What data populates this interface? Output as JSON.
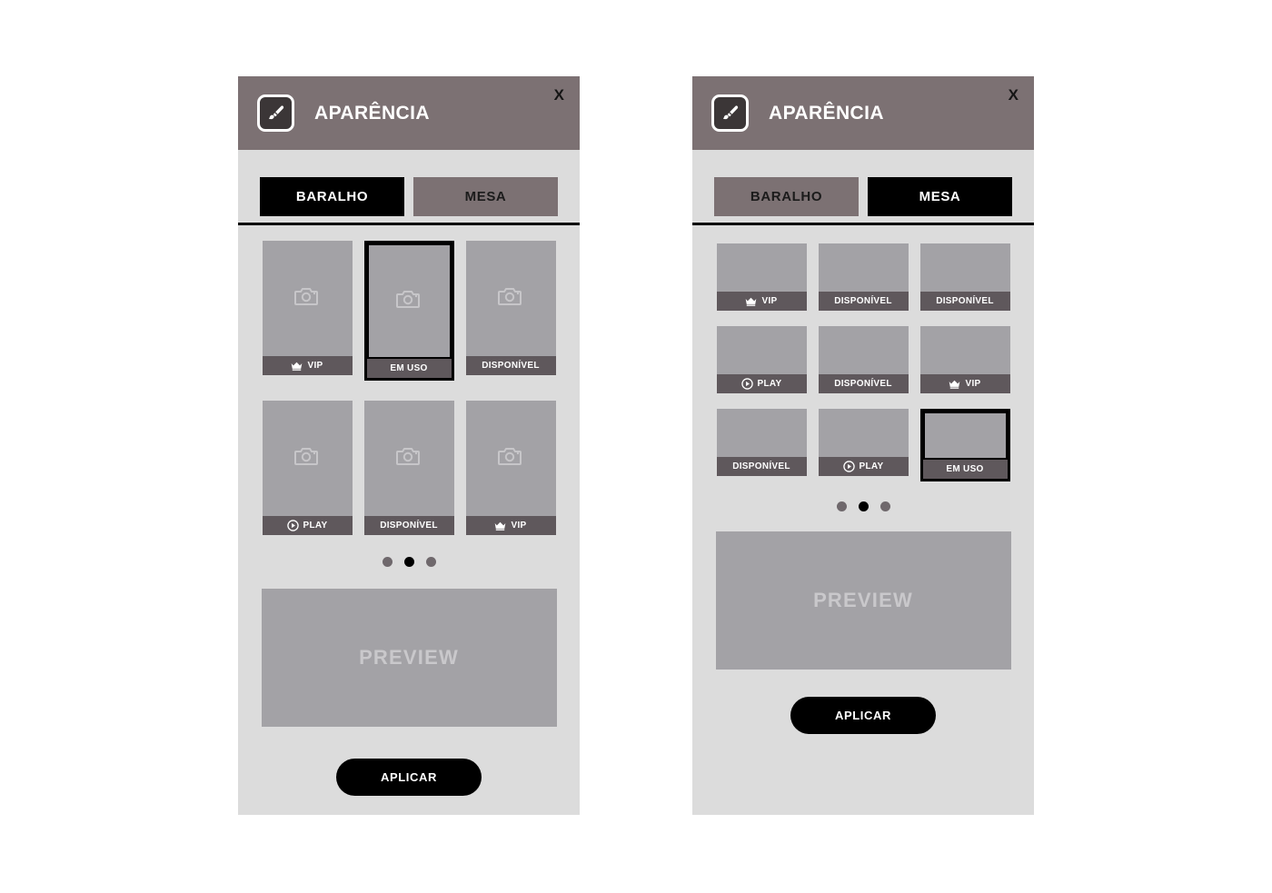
{
  "panels": [
    {
      "id": "baralho",
      "header": {
        "title": "APARÊNCIA",
        "icon": "paintbrush-icon",
        "close_label": "X"
      },
      "tabs": [
        {
          "label": "BARALHO",
          "active": true
        },
        {
          "label": "MESA",
          "active": false
        }
      ],
      "cards": [
        {
          "label": "VIP",
          "icon": "crown-icon",
          "thumb_icon": "camera-icon",
          "selected": false
        },
        {
          "label": "EM USO",
          "icon": null,
          "thumb_icon": "camera-icon",
          "selected": true
        },
        {
          "label": "DISPONÍVEL",
          "icon": null,
          "thumb_icon": "camera-icon",
          "selected": false
        },
        {
          "label": "PLAY",
          "icon": "play-icon",
          "thumb_icon": "camera-icon",
          "selected": false
        },
        {
          "label": "DISPONÍVEL",
          "icon": null,
          "thumb_icon": "camera-icon",
          "selected": false
        },
        {
          "label": "VIP",
          "icon": "crown-icon",
          "thumb_icon": "camera-icon",
          "selected": false
        }
      ],
      "pagination": {
        "count": 3,
        "active_index": 1
      },
      "preview": {
        "label": "PREVIEW"
      },
      "apply": {
        "label": "APLICAR"
      }
    },
    {
      "id": "mesa",
      "header": {
        "title": "APARÊNCIA",
        "icon": "paintbrush-icon",
        "close_label": "X"
      },
      "tabs": [
        {
          "label": "BARALHO",
          "active": false
        },
        {
          "label": "MESA",
          "active": true
        }
      ],
      "cards": [
        {
          "label": "VIP",
          "icon": "crown-icon",
          "thumb_icon": null,
          "selected": false
        },
        {
          "label": "DISPONÍVEL",
          "icon": null,
          "thumb_icon": null,
          "selected": false
        },
        {
          "label": "DISPONÍVEL",
          "icon": null,
          "thumb_icon": null,
          "selected": false
        },
        {
          "label": "PLAY",
          "icon": "play-icon",
          "thumb_icon": null,
          "selected": false
        },
        {
          "label": "DISPONÍVEL",
          "icon": null,
          "thumb_icon": null,
          "selected": false
        },
        {
          "label": "VIP",
          "icon": "crown-icon",
          "thumb_icon": null,
          "selected": false
        },
        {
          "label": "DISPONÍVEL",
          "icon": null,
          "thumb_icon": null,
          "selected": false
        },
        {
          "label": "PLAY",
          "icon": "play-icon",
          "thumb_icon": null,
          "selected": false
        },
        {
          "label": "EM USO",
          "icon": null,
          "thumb_icon": null,
          "selected": true
        }
      ],
      "pagination": {
        "count": 3,
        "active_index": 1
      },
      "preview": {
        "label": "PREVIEW"
      },
      "apply": {
        "label": "APLICAR"
      }
    }
  ],
  "colors": {
    "panel_background": "#dcdcdc",
    "header_background": "#7c7173",
    "tab_active": "#000000",
    "tab_inactive": "#7c7173",
    "card_thumb": "#a3a2a6",
    "card_label": "#5f585c",
    "dot_active": "#000000",
    "dot_inactive": "#6f686c",
    "apply_button": "#000000",
    "preview_text": "#c9c8cb"
  }
}
